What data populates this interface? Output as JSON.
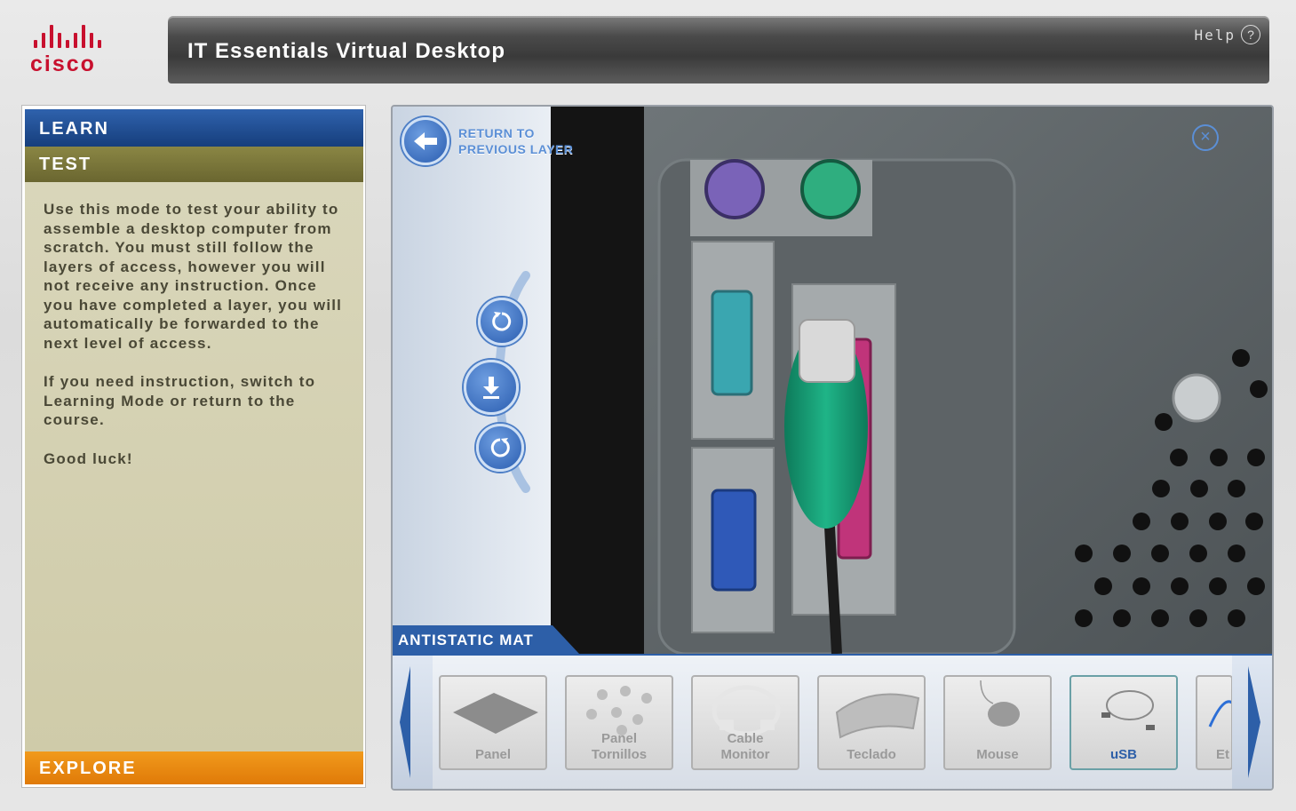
{
  "header": {
    "logo_text": "cisco",
    "title": "IT Essentials Virtual Desktop",
    "help_label": "Help",
    "help_icon": "?"
  },
  "sidebar": {
    "learn_tab": "LEARN",
    "test_tab": "TEST",
    "explore_tab": "EXPLORE",
    "paragraphs": [
      "Use this mode to test your ability to assemble a desktop computer from scratch. You must still follow the layers of access, however you will not receive any instruction. Once you have completed a layer, you will automatically be forwarded to the next level of access.",
      "If you need instruction, switch to Learning Mode or return to the course.",
      "Good luck!"
    ]
  },
  "viewer": {
    "return_line1": "RETURN TO",
    "return_line2": "PREVIOUS LAYER",
    "layer_label": "ANTISTATIC MAT"
  },
  "tray": {
    "items": [
      {
        "line1": "",
        "line2": "Panel"
      },
      {
        "line1": "Panel",
        "line2": "Tornillos"
      },
      {
        "line1": "Cable",
        "line2": "Monitor"
      },
      {
        "line1": "",
        "line2": "Teclado"
      },
      {
        "line1": "",
        "line2": "Mouse"
      },
      {
        "line1": "",
        "line2": "uSB"
      },
      {
        "line1": "",
        "line2": "Et"
      }
    ]
  },
  "colors": {
    "learn": "#2f62ad",
    "test": "#7a7638",
    "explore": "#f08c10",
    "accent": "#2d5fa8",
    "cisco_red": "#c8102e"
  }
}
